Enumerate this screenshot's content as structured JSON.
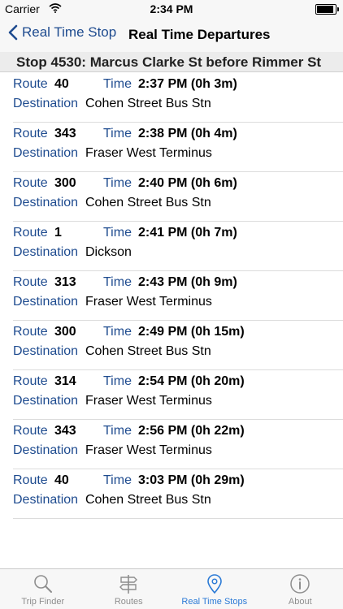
{
  "status_bar": {
    "carrier": "Carrier",
    "time": "2:34 PM"
  },
  "nav": {
    "back_label": "Real Time Stop",
    "title": "Real Time Departures"
  },
  "stop_header": "Stop 4530: Marcus Clarke St before Rimmer St",
  "labels": {
    "route": "Route",
    "time": "Time",
    "destination": "Destination"
  },
  "departures": [
    {
      "route": "40",
      "time": "2:37 PM (0h 3m)",
      "destination": "Cohen Street Bus Stn"
    },
    {
      "route": "343",
      "time": "2:38 PM (0h 4m)",
      "destination": "Fraser West Terminus"
    },
    {
      "route": "300",
      "time": "2:40 PM (0h 6m)",
      "destination": "Cohen Street Bus Stn"
    },
    {
      "route": "1",
      "time": "2:41 PM (0h 7m)",
      "destination": "Dickson"
    },
    {
      "route": "313",
      "time": "2:43 PM (0h 9m)",
      "destination": "Fraser West Terminus"
    },
    {
      "route": "300",
      "time": "2:49 PM (0h 15m)",
      "destination": "Cohen Street Bus Stn"
    },
    {
      "route": "314",
      "time": "2:54 PM (0h 20m)",
      "destination": "Fraser West Terminus"
    },
    {
      "route": "343",
      "time": "2:56 PM (0h 22m)",
      "destination": "Fraser West Terminus"
    },
    {
      "route": "40",
      "time": "3:03 PM (0h 29m)",
      "destination": "Cohen Street Bus Stn"
    }
  ],
  "tabs": [
    {
      "label": "Trip Finder",
      "icon": "magnifier-icon"
    },
    {
      "label": "Routes",
      "icon": "signpost-icon"
    },
    {
      "label": "Real Time Stops",
      "icon": "location-pin-icon",
      "active": true
    },
    {
      "label": "About",
      "icon": "info-icon"
    }
  ],
  "colors": {
    "accent": "#1e4b8f",
    "active_tab": "#2b7ad6",
    "inactive_tab": "#8e8e8e"
  }
}
